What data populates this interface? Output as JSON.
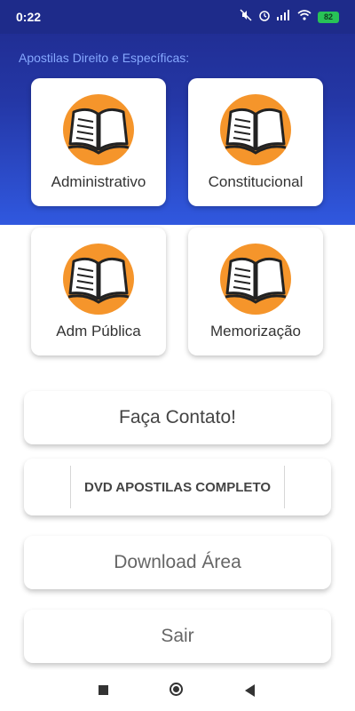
{
  "status": {
    "time": "0:22",
    "battery": "82",
    "icons": [
      "mute-icon",
      "alarm-icon",
      "signal-icon",
      "wifi-icon",
      "battery-icon"
    ]
  },
  "header": {
    "section_title": "Apostilas Direito e Específicas:"
  },
  "categories": [
    {
      "label": "Administrativo",
      "icon": "book-icon"
    },
    {
      "label": "Constitucional",
      "icon": "book-icon"
    },
    {
      "label": "Adm Pública",
      "icon": "book-icon"
    },
    {
      "label": "Memorização",
      "icon": "book-icon"
    }
  ],
  "buttons": {
    "contact": "Faça Contato!",
    "dvd": "DVD APOSTILAS COMPLETO",
    "download": "Download Área",
    "exit": "Sair"
  },
  "colors": {
    "header_top": "#1f2a8c",
    "header_bottom": "#3058df",
    "book_circle": "#f5952b",
    "title_accent": "#86a8ff"
  }
}
